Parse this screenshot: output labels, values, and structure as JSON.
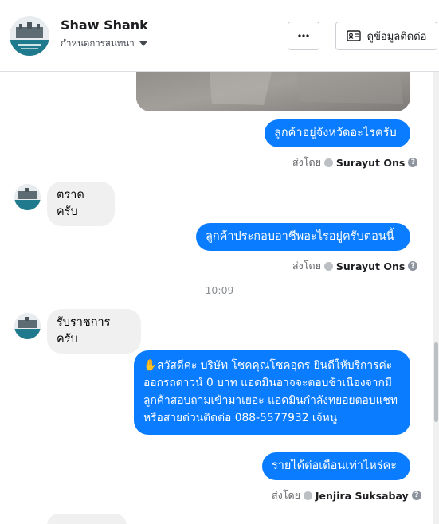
{
  "header": {
    "contact_name": "Shaw Shank",
    "assign_label": "กำหนดการสนทนา",
    "contact_button_label": "ดูข้อมูลติดต่อ"
  },
  "conversation": {
    "messages": [
      {
        "direction": "outgoing",
        "text": "ลูกค้าอยู่จังหวัดอะไรครับ"
      },
      {
        "sent_by_label": "ส่งโดย",
        "agent": "Surayut Ons"
      },
      {
        "direction": "incoming",
        "text": "ตราดครับ"
      },
      {
        "direction": "outgoing",
        "text": "ลูกค้าประกอบอาชีพอะไรอยู่ครับตอนนี้"
      },
      {
        "sent_by_label": "ส่งโดย",
        "agent": "Surayut Ons"
      },
      {
        "timestamp": "10:09"
      },
      {
        "direction": "incoming",
        "text": "รับราชการครับ"
      },
      {
        "direction": "outgoing",
        "text": "✋สวัสดีค่ะ บริษัท โชคคุณโชคอุดร ยินดีให้บริการค่ะ ออกรถดาวน์ 0 บาท แอดมินอาจจะตอบช้าเนื่องจากมีลูกค้าสอบถามเข้ามาเยอะ แอดมินกำลังทยอยตอบแชท หรือสายด่วนติดต่อ 088-5577932 เจ้หนู"
      },
      {
        "direction": "outgoing",
        "text": "รายได้ต่อเดือนเท่าไหร่คะ"
      },
      {
        "sent_by_label": "ส่งโดย",
        "agent": "Jenjira Suksabay"
      }
    ]
  },
  "colors": {
    "outgoing_bubble": "#0a7cff",
    "incoming_bubble": "#f0f0f0",
    "meta_text": "#65676b"
  },
  "icons": {
    "more": "more-icon",
    "contact_card": "contact-card-icon",
    "help": "help-icon"
  }
}
